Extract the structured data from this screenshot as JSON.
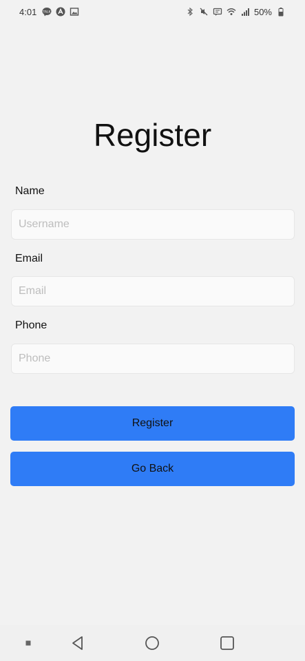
{
  "status_bar": {
    "time": "4:01",
    "battery": "50%",
    "left_icons": [
      "talk-icon",
      "vpn-icon",
      "image-icon"
    ],
    "right_icons": [
      "bluetooth-icon",
      "mute-icon",
      "message-icon",
      "wifi-icon",
      "signal-icon",
      "battery-icon"
    ]
  },
  "title": "Register",
  "form": {
    "name": {
      "label": "Name",
      "placeholder": "Username",
      "value": ""
    },
    "email": {
      "label": "Email",
      "placeholder": "Email",
      "value": ""
    },
    "phone": {
      "label": "Phone",
      "placeholder": "Phone",
      "value": ""
    }
  },
  "buttons": {
    "register": "Register",
    "go_back": "Go Back"
  },
  "colors": {
    "background": "#f2f2f2",
    "button": "#2f7cf6",
    "input_background": "#fafafa"
  },
  "nav_bar": {
    "items": [
      "recents-dot-icon",
      "back-icon",
      "home-icon",
      "overview-icon"
    ]
  }
}
